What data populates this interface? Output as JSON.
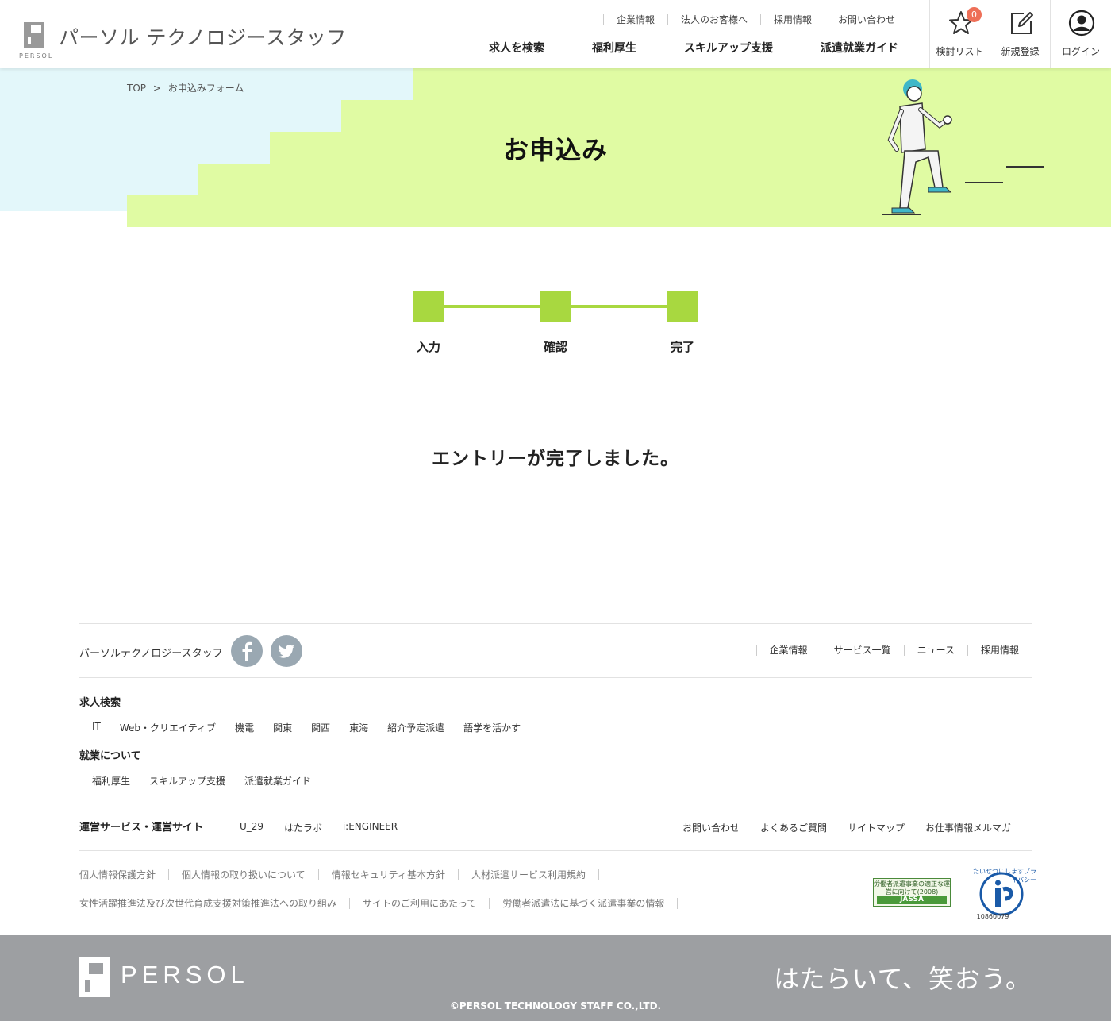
{
  "header": {
    "site_name": "パーソル テクノロジースタッフ",
    "logo_word": "PERSOL",
    "subnav": [
      "企業情報",
      "法人のお客様へ",
      "採用情報",
      "お問い合わせ"
    ],
    "mainnav": [
      "求人を検索",
      "福利厚生",
      "スキルアップ支援",
      "派遣就業ガイド"
    ],
    "buttons": {
      "favorites": "検討リスト",
      "favorites_count": "0",
      "register": "新規登録",
      "login": "ログイン"
    }
  },
  "hero": {
    "breadcrumb": [
      "TOP",
      ">",
      "お申込みフォーム"
    ],
    "title": "お申込み"
  },
  "progress": {
    "steps": [
      "入力",
      "確認",
      "完了"
    ],
    "color": "#a8d840"
  },
  "message": "エントリーが完了しました。",
  "footer": {
    "company": "パーソルテクノロジースタッフ",
    "social": [
      "facebook-icon",
      "twitter-icon"
    ],
    "top_links": [
      "企業情報",
      "サービス一覧",
      "ニュース",
      "採用情報"
    ],
    "search_title": "求人検索",
    "search_links": [
      "IT",
      "Web・クリエイティブ",
      "機電",
      "関東",
      "関西",
      "東海",
      "紹介予定派遣",
      "語学を活かす"
    ],
    "work_title": "就業について",
    "work_links": [
      "福利厚生",
      "スキルアップ支援",
      "派遣就業ガイド"
    ],
    "services_title": "運営サービス・運営サイト",
    "services": [
      "U_29",
      "はたラボ",
      "i:ENGINEER"
    ],
    "services_right": [
      "お問い合わせ",
      "よくあるご質問",
      "サイトマップ",
      "お仕事情報メルマガ"
    ],
    "legal_row1": [
      "個人情報保護方針",
      "個人情報の取り扱いについて",
      "情報セキュリティ基本方針",
      "人材派遣サービス利用規約"
    ],
    "legal_row2": [
      "女性活躍推進法及び次世代育成支援対策推進法への取り組み",
      "サイトのご利用にあたって",
      "労働者派遣法に基づく派遣事業の情報"
    ],
    "jassa_text": "労働者派遣事業の適正な運営に向けて(2008)",
    "jassa_label": "JASSA",
    "privacy_text": "たいせつにしますプライバシー",
    "privacy_number": "10860079",
    "brand": "PERSOL",
    "slogan": "はたらいて、笑おう。",
    "copyright": "©PERSOL TECHNOLOGY STAFF CO.,LTD."
  }
}
